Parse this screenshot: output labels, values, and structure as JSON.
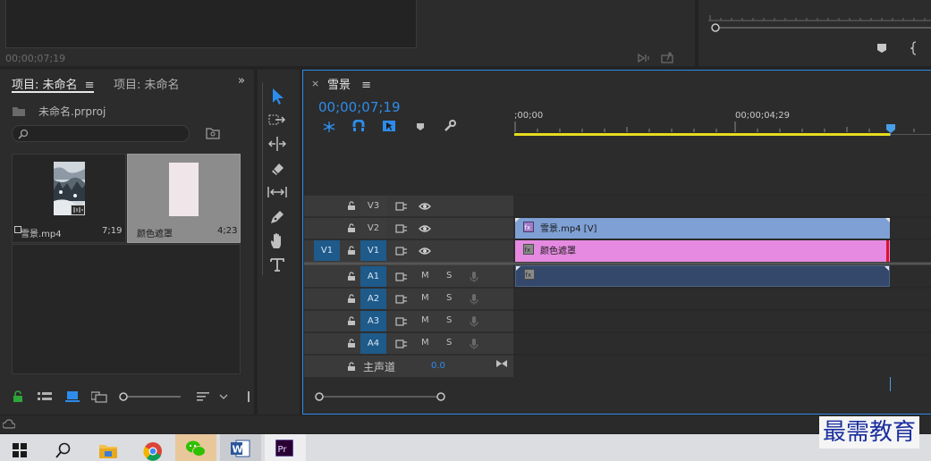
{
  "top_left_monitor": {
    "timecode": "00;00;07;19"
  },
  "project_panel": {
    "tabs": [
      {
        "label": "项目: 未命名",
        "active": true
      },
      {
        "label": "项目: 未命名",
        "active": false
      }
    ],
    "project_file": "未命名.prproj",
    "search_placeholder": "",
    "items": [
      {
        "name": "雪景.mp4",
        "duration": "7;19"
      },
      {
        "name": "颜色遮罩",
        "duration": "4;23"
      }
    ]
  },
  "timeline": {
    "sequence_tab": "雪景",
    "timecode": "00;00;07;19",
    "ruler_labels": [
      ";00;00",
      "00;00;04;29"
    ],
    "video_tracks": [
      "V3",
      "V2",
      "V1"
    ],
    "source_patch": "V1",
    "audio_tracks": [
      "A1",
      "A2",
      "A3",
      "A4"
    ],
    "mute_label": "M",
    "solo_label": "S",
    "master": {
      "label": "主声道",
      "value": "0.0"
    },
    "clips": [
      {
        "track": "V2",
        "label": "雪景.mp4 [V]",
        "color": "#7fa0d4"
      },
      {
        "track": "V1",
        "label": "颜色遮罩",
        "color": "#e58ae0"
      },
      {
        "track": "A1",
        "label": "",
        "color": "#33486a"
      }
    ]
  },
  "watermark": "最需教育",
  "colors": {
    "accent": "#2d8ceb",
    "in_out_bar": "#e6dc1e",
    "playhead": "#4a9de8"
  },
  "taskbar": {
    "apps": [
      "windows-start",
      "search",
      "file-explorer",
      "chrome",
      "wechat",
      "word",
      "premiere-pro"
    ]
  }
}
